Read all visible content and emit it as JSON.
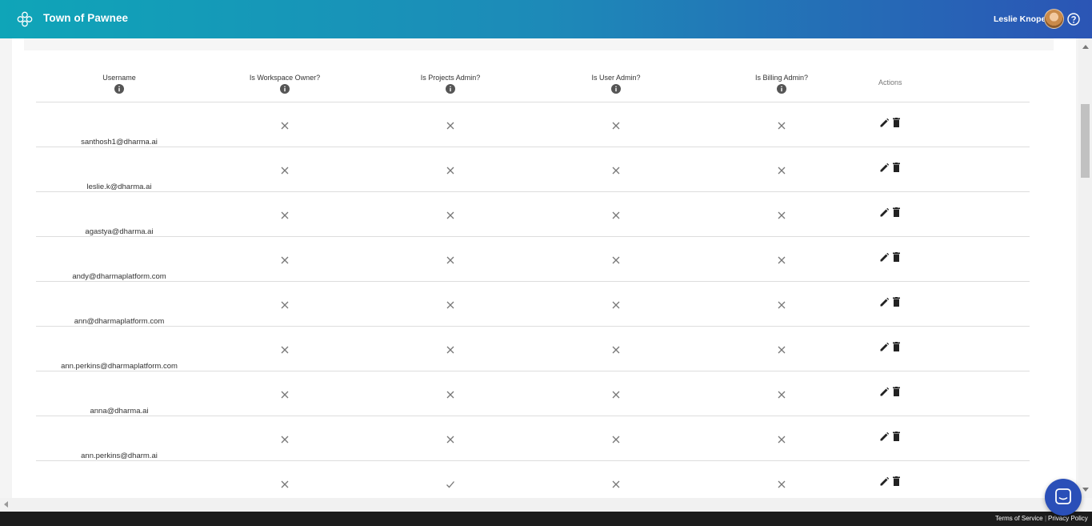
{
  "header": {
    "app_title": "Town of Pawnee",
    "user_name": "Leslie Knope"
  },
  "table": {
    "columns": [
      "Username",
      "Is Workspace Owner?",
      "Is Projects Admin?",
      "Is User Admin?",
      "Is Billing Admin?"
    ],
    "actions_label": "Actions",
    "rows": [
      {
        "username": "santhosh1@dharma.ai",
        "workspace_owner": false,
        "projects_admin": false,
        "user_admin": false,
        "billing_admin": false
      },
      {
        "username": "leslie.k@dharma.ai",
        "workspace_owner": false,
        "projects_admin": false,
        "user_admin": false,
        "billing_admin": false
      },
      {
        "username": "agastya@dharma.ai",
        "workspace_owner": false,
        "projects_admin": false,
        "user_admin": false,
        "billing_admin": false
      },
      {
        "username": "andy@dharmaplatform.com",
        "workspace_owner": false,
        "projects_admin": false,
        "user_admin": false,
        "billing_admin": false
      },
      {
        "username": "ann@dharmaplatform.com",
        "workspace_owner": false,
        "projects_admin": false,
        "user_admin": false,
        "billing_admin": false
      },
      {
        "username": "ann.perkins@dharmaplatform.com",
        "workspace_owner": false,
        "projects_admin": false,
        "user_admin": false,
        "billing_admin": false
      },
      {
        "username": "anna@dharma.ai",
        "workspace_owner": false,
        "projects_admin": false,
        "user_admin": false,
        "billing_admin": false
      },
      {
        "username": "ann.perkins@dharm.ai",
        "workspace_owner": false,
        "projects_admin": false,
        "user_admin": false,
        "billing_admin": false
      },
      {
        "username": "",
        "workspace_owner": false,
        "projects_admin": true,
        "user_admin": false,
        "billing_admin": false
      }
    ]
  },
  "footer": {
    "terms": "Terms of Service",
    "privacy": "Privacy Policy",
    "separator": "|"
  },
  "icons": {
    "logo": "flower-logo-icon",
    "help": "help-circle-icon",
    "info": "info-icon",
    "false_mark": "cross-icon",
    "true_mark": "check-icon",
    "edit": "pencil-icon",
    "delete": "trash-icon",
    "chat": "chat-icon"
  },
  "colors": {
    "header_start": "#0fa5b8",
    "header_end": "#2b55b5",
    "chat": "#2a4fb8",
    "footer": "#1c1c1c"
  }
}
